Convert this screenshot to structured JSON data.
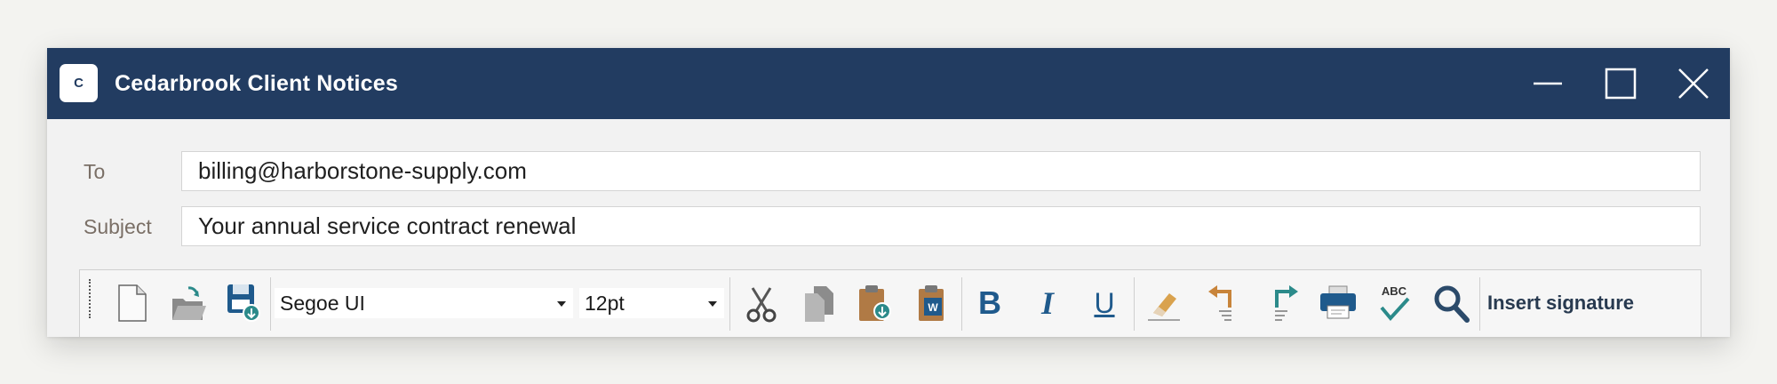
{
  "window": {
    "app_icon_letter": "C",
    "title": "Cedarbrook Client Notices",
    "controls": [
      "minimize-icon",
      "maximize-icon",
      "close-icon"
    ]
  },
  "compose": {
    "to_label": "To",
    "to_value": "billing@harborstone-supply.com",
    "subject_label": "Subject",
    "subject_value": "Your annual service contract renewal"
  },
  "toolbar": {
    "font_family": "Segoe UI",
    "font_size": "12pt",
    "bold_glyph": "B",
    "italic_glyph": "I",
    "underline_glyph": "U",
    "spellcheck_text": "ABC",
    "insert_signature_label": "Insert signature",
    "icons": [
      "new-document-icon",
      "open-folder-icon",
      "save-icon",
      "cut-icon",
      "copy-icon",
      "paste-icon",
      "paste-word-icon",
      "bold-icon",
      "italic-icon",
      "underline-icon",
      "eraser-icon",
      "undo-icon",
      "redo-icon",
      "print-icon",
      "spellcheck-icon",
      "search-icon"
    ],
    "colors": {
      "titlebar": "#223c61",
      "icon_blue": "#1f5a8c",
      "icon_teal": "#2b8a8a",
      "icon_orange": "#c8843a"
    }
  }
}
